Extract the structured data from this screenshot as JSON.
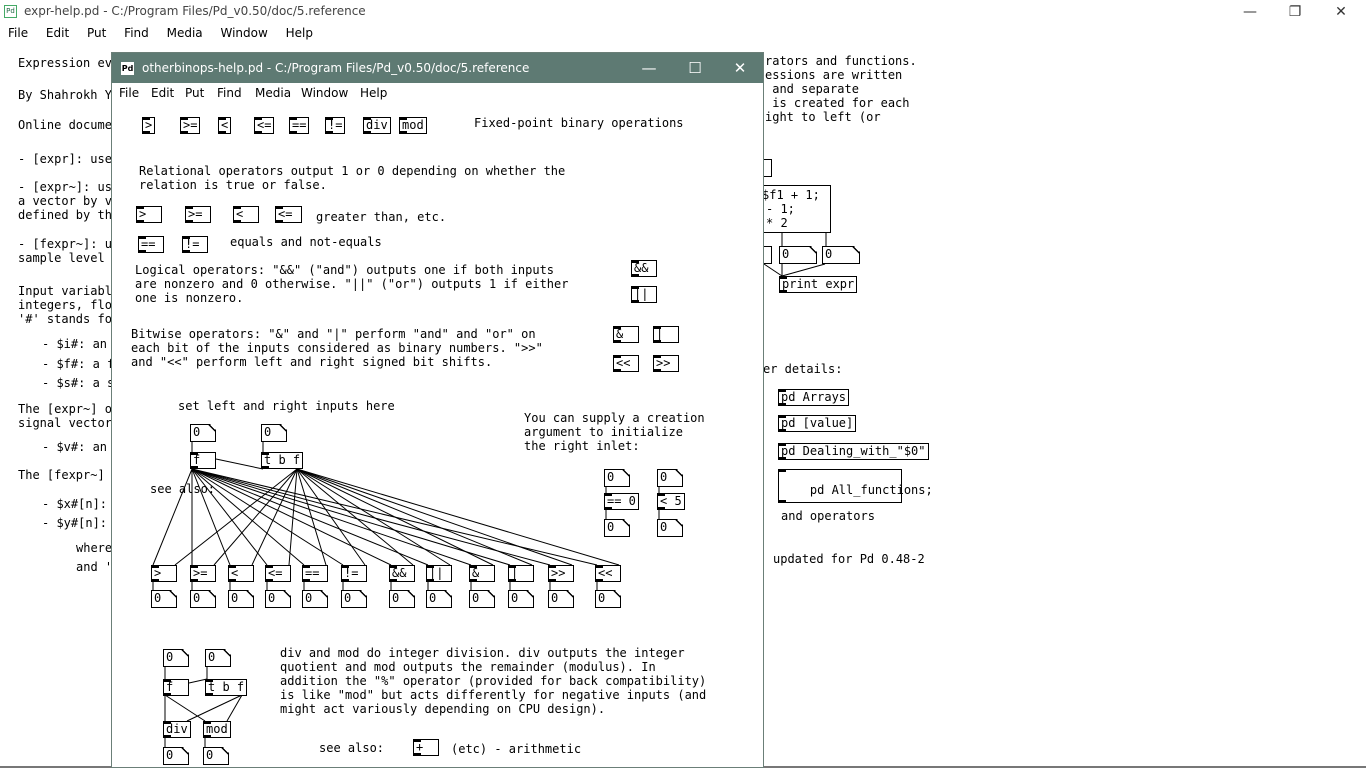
{
  "background_window": {
    "title": "expr-help.pd  - C:/Program Files/Pd_v0.50/doc/5.reference",
    "menu": [
      "File",
      "Edit",
      "Put",
      "Find",
      "Media",
      "Window",
      "Help"
    ],
    "controls": {
      "minimize": "—",
      "restore": "❐",
      "close": "✕"
    },
    "left_text": [
      "Expression eva",
      "By Shahrokh Ya",
      "Online documen",
      "- [expr]: used",
      "- [expr~]: use",
      "a vector by ve",
      "defined by the",
      "- [fexpr~]: us",
      "sample level (",
      "Input variable",
      "integers, floa",
      "'#' stands for",
      "- $i#: an",
      "- $f#: a f",
      "- $s#: a s",
      "The [expr~] ob",
      "signal vectors",
      "- $v#: an",
      "The [fexpr~] o",
      "- $x#[n]:",
      "- $y#[n]:",
      "where",
      "and '"
    ],
    "right_text": [
      "rators and functions.",
      "essions are written",
      " and separate",
      " is created for each",
      "ight to left (or",
      "er details:",
      "updated for Pd 0.48-2"
    ],
    "expr_box": [
      "$f1 + 1;",
      "- 1;",
      "* 2"
    ],
    "print_box": "print expr",
    "num_zero": "0",
    "subpatches": [
      "pd Arrays",
      "pd [value]",
      "pd Dealing_with_\"$0\"",
      "pd All_functions;",
      "and operators"
    ]
  },
  "front_window": {
    "title": "otherbinops-help.pd  - C:/Program Files/Pd_v0.50/doc/5.reference",
    "icon_label": "Pd",
    "controls": {
      "minimize": "—",
      "maximize": "☐",
      "close": "✕"
    },
    "menu": [
      "File",
      "Edit",
      "Put",
      "Find",
      "Media",
      "Window",
      "Help"
    ],
    "top_ops": [
      ">",
      ">=",
      "<",
      "<=",
      "==",
      "!=",
      "div",
      "mod"
    ],
    "heading": "Fixed-point binary operations",
    "relational_text": "Relational operators output 1 or 0 depending on whether the\nrelation is true or false.",
    "rel_ops": [
      ">",
      ">=",
      "<",
      "<="
    ],
    "rel_label": "greater than, etc.",
    "eq_ops": [
      "==",
      "!="
    ],
    "eq_label": "equals and not-equals",
    "logical_text": "Logical operators: \"&&\" (\"and\") outputs one if both inputs\nare nonzero and 0 otherwise. \"||\" (\"or\") outputs 1 if either\none is nonzero.",
    "logical_ops": [
      "&&",
      "||"
    ],
    "bitwise_text": "Bitwise operators: \"&\" and \"|\" perform \"and\" and \"or\" on\neach bit of the inputs considered as binary numbers. \">>\"\nand \"<<\" perform left and right signed bit shifts.",
    "bitwise_ops": [
      "&",
      "|",
      "<<",
      ">>"
    ],
    "set_inputs_label": "set left and right inputs here",
    "creation_text": "You can supply a creation\nargument to initialize\nthe right inlet:",
    "zero": "0",
    "f_obj": "f",
    "tbf_obj": "t b f",
    "see_also_1": "see also:",
    "eq0": "== 0",
    "lt5": "< 5",
    "bottom_ops": [
      ">",
      ">=",
      "<",
      "<=",
      "==",
      "!=",
      "&&",
      "||",
      "&",
      "|",
      ">>",
      "<<"
    ],
    "divmod_text": "div and mod do integer division. div outputs the integer\nquotient and mod outputs the remainder (modulus). In\naddition the \"%\" operator (provided for back compatibility)\nis like \"mod\" but acts differently for negative inputs (and\nmight act variously depending on CPU design).",
    "div": "div",
    "mod": "mod",
    "see_also_2": "see also:",
    "plus_obj": "+",
    "arith_label": "(etc) - arithmetic"
  }
}
